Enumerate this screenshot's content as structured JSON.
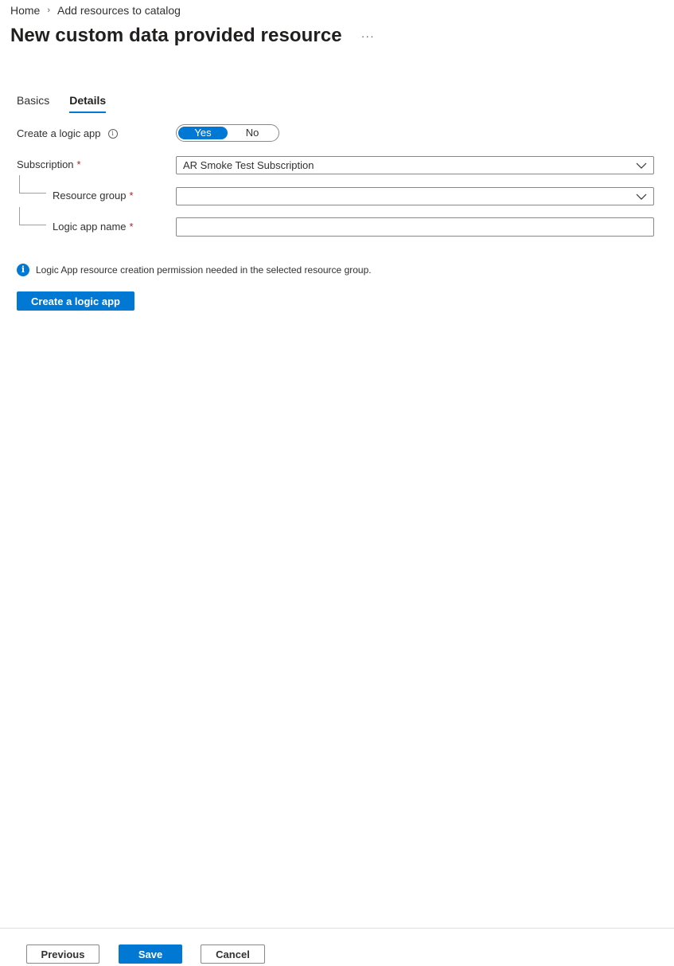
{
  "breadcrumb": {
    "items": [
      "Home",
      "Add resources to catalog"
    ],
    "separator": "›"
  },
  "header": {
    "title": "New custom data provided resource",
    "more_label": "···"
  },
  "tabs": [
    {
      "label": "Basics",
      "active": false
    },
    {
      "label": "Details",
      "active": true
    }
  ],
  "form": {
    "create_logic_app": {
      "label": "Create a logic app",
      "info_icon": "info-icon",
      "options": [
        "Yes",
        "No"
      ],
      "selected": "Yes"
    },
    "subscription": {
      "label": "Subscription",
      "required_mark": "*",
      "value": "AR Smoke Test Subscription"
    },
    "resource_group": {
      "label": "Resource group",
      "required_mark": "*",
      "value": ""
    },
    "logic_app_name": {
      "label": "Logic app name",
      "required_mark": "*",
      "value": ""
    }
  },
  "info_message": {
    "icon": "info-circle-icon",
    "text": "Logic App resource creation permission needed in the selected resource group."
  },
  "create_button_label": "Create a logic app",
  "footer": {
    "previous_label": "Previous",
    "save_label": "Save",
    "cancel_label": "Cancel"
  },
  "colors": {
    "accent": "#0078d4",
    "required": "#a4262c"
  }
}
